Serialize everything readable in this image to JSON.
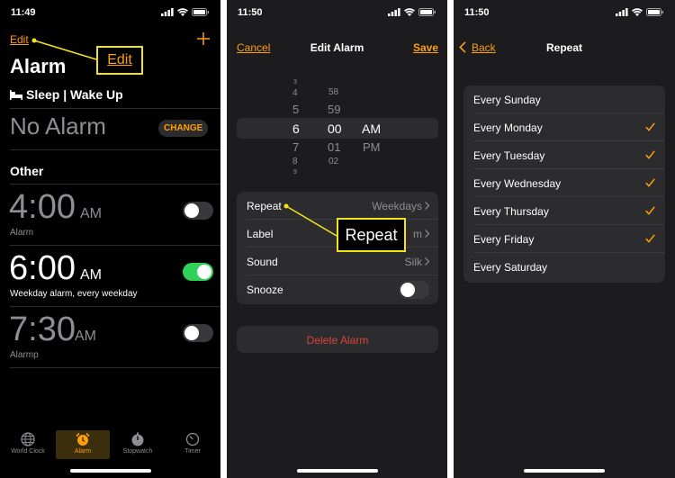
{
  "panel1": {
    "status_time": "11:49",
    "edit": "Edit",
    "title": "Alarm",
    "sleep_heading": "Sleep | Wake Up",
    "no_alarm": "No Alarm",
    "change": "CHANGE",
    "other": "Other",
    "alarms": [
      {
        "time": "4:00",
        "ampm": "AM",
        "label": "Alarm",
        "enabled": false
      },
      {
        "time": "6:00",
        "ampm": "AM",
        "label": "Weekday alarm, every weekday",
        "enabled": true
      },
      {
        "time": "7:30",
        "ampm": "AM",
        "label": "Alarmp",
        "enabled": false
      }
    ],
    "callout": "Edit",
    "tabs": [
      "World Clock",
      "Alarm",
      "Stopwatch",
      "Timer"
    ],
    "active_tab": "Alarm"
  },
  "panel2": {
    "status_time": "11:50",
    "cancel": "Cancel",
    "title": "Edit Alarm",
    "save": "Save",
    "picker": {
      "hours": [
        "3",
        "4",
        "5",
        "6",
        "7",
        "8",
        "9"
      ],
      "minutes": [
        "58",
        "59",
        "00",
        "01",
        "02"
      ],
      "selected_hour": "6",
      "selected_minute": "00",
      "selected_period": "AM",
      "other_period": "PM"
    },
    "rows": [
      {
        "label": "Repeat",
        "value": "Weekdays"
      },
      {
        "label": "Label",
        "value": "m"
      },
      {
        "label": "Sound",
        "value": "Silk"
      },
      {
        "label": "Snooze",
        "value": ""
      }
    ],
    "snooze_enabled": false,
    "delete": "Delete Alarm",
    "callout": "Repeat"
  },
  "panel3": {
    "status_time": "11:50",
    "back": "Back",
    "title": "Repeat",
    "days": [
      {
        "label": "Every Sunday",
        "checked": false
      },
      {
        "label": "Every Monday",
        "checked": true
      },
      {
        "label": "Every Tuesday",
        "checked": true
      },
      {
        "label": "Every Wednesday",
        "checked": true
      },
      {
        "label": "Every Thursday",
        "checked": true
      },
      {
        "label": "Every Friday",
        "checked": true
      },
      {
        "label": "Every Saturday",
        "checked": false
      }
    ]
  },
  "colors": {
    "accent": "#ff9f0a",
    "toggle_on": "#30d158",
    "callout": "#f5e31a",
    "delete": "#d9443a"
  },
  "icons": [
    "location-arrow-icon",
    "signal-icon",
    "wifi-icon",
    "battery-icon",
    "plus-icon",
    "bed-icon",
    "chevron-right-icon",
    "chevron-left-icon",
    "checkmark-icon",
    "globe-icon",
    "alarm-clock-icon",
    "stopwatch-icon",
    "timer-icon"
  ]
}
